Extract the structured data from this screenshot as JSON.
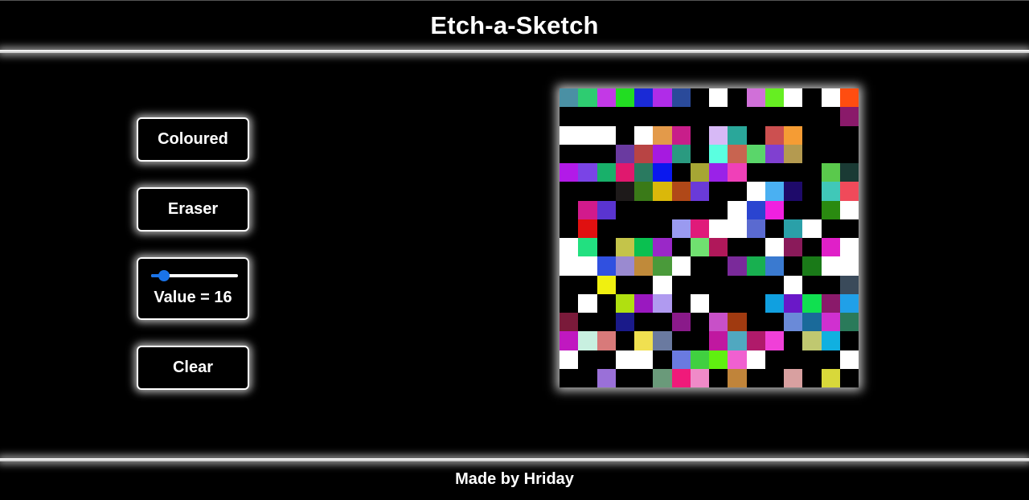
{
  "header": {
    "title": "Etch-a-Sketch"
  },
  "controls": {
    "coloured_label": "Coloured",
    "eraser_label": "Eraser",
    "slider": {
      "value": 16,
      "min": 1,
      "max": 100,
      "label": "Value = 16"
    },
    "clear_label": "Clear"
  },
  "grid": {
    "size": 16,
    "cells": [
      [
        "#4a90a4",
        "#2ecc71",
        "#c339e6",
        "#22dd22",
        "#1a2ad6",
        "#b02ce8",
        "#2a4a9a",
        "#000000",
        "#ffffff",
        "#000000",
        "#d070d8",
        "#66ee22",
        "#ffffff",
        "#000000",
        "#ffffff",
        "#ff4d10"
      ],
      [
        "#000000",
        "#000000",
        "#000000",
        "#000000",
        "#000000",
        "#000000",
        "#000000",
        "#000000",
        "#000000",
        "#000000",
        "#000000",
        "#000000",
        "#000000",
        "#000000",
        "#000000",
        "#8a1a6a"
      ],
      [
        "#ffffff",
        "#ffffff",
        "#ffffff",
        "#000000",
        "#ffffff",
        "#e39a4a",
        "#c81e8a",
        "#000000",
        "#d7b9f6",
        "#2aa79a",
        "#000000",
        "#cc5050",
        "#f59c34",
        "#000000",
        "#000000",
        "#000000"
      ],
      [
        "#000000",
        "#000000",
        "#000000",
        "#6a3aa0",
        "#b84444",
        "#a61ae0",
        "#2a9a80",
        "#000000",
        "#5affe0",
        "#c86450",
        "#5ad66a",
        "#8040d0",
        "#b49a50",
        "#000000",
        "#000000",
        "#000000"
      ],
      [
        "#b21ae8",
        "#7a44e6",
        "#18b06a",
        "#e0186e",
        "#2a7a60",
        "#0a18ee",
        "#000000",
        "#a6a634",
        "#9a22e8",
        "#f040b8",
        "#000000",
        "#000000",
        "#000000",
        "#000000",
        "#5ac94c",
        "#1a3a34"
      ],
      [
        "#000000",
        "#000000",
        "#000000",
        "#1e1a1a",
        "#3a7a18",
        "#dab80a",
        "#b04818",
        "#6a3ad8",
        "#000000",
        "#000000",
        "#ffffff",
        "#4ab0f2",
        "#1e0a6a",
        "#000000",
        "#40c8b8",
        "#f04a5a"
      ],
      [
        "#000000",
        "#d21a8c",
        "#5a34d0",
        "#000000",
        "#000000",
        "#000000",
        "#000000",
        "#000000",
        "#000000",
        "#ffffff",
        "#2a44d0",
        "#f020e0",
        "#000000",
        "#000000",
        "#2a8a10",
        "#ffffff"
      ],
      [
        "#000000",
        "#e01010",
        "#000000",
        "#000000",
        "#000000",
        "#000000",
        "#9a9af0",
        "#e01a7a",
        "#ffffff",
        "#ffffff",
        "#5a6ad0",
        "#000000",
        "#2aa0a8",
        "#ffffff",
        "#000000",
        "#000000"
      ],
      [
        "#ffffff",
        "#22e080",
        "#000000",
        "#c4c44a",
        "#0ac050",
        "#9a28c8",
        "#000000",
        "#70e070",
        "#b0185a",
        "#000000",
        "#000000",
        "#ffffff",
        "#8a1a5a",
        "#000000",
        "#e020c8",
        "#ffffff"
      ],
      [
        "#ffffff",
        "#ffffff",
        "#3050e0",
        "#9a8ad0",
        "#c08a3a",
        "#4a9a3a",
        "#ffffff",
        "#000000",
        "#000000",
        "#7a2a9a",
        "#18b050",
        "#3a7ad0",
        "#000000",
        "#1a7a18",
        "#ffffff",
        "#ffffff"
      ],
      [
        "#000000",
        "#000000",
        "#f0f010",
        "#000000",
        "#000000",
        "#ffffff",
        "#000000",
        "#000000",
        "#000000",
        "#000000",
        "#000000",
        "#000000",
        "#ffffff",
        "#000000",
        "#000000",
        "#3a4a5a"
      ],
      [
        "#000000",
        "#ffffff",
        "#000000",
        "#b0e010",
        "#9a18c0",
        "#b09af0",
        "#000000",
        "#ffffff",
        "#000000",
        "#000000",
        "#000000",
        "#10a0e0",
        "#6a18c8",
        "#10e050",
        "#8a1a6a",
        "#20a0e8"
      ],
      [
        "#7a1a3a",
        "#000000",
        "#000000",
        "#1a1a8a",
        "#000000",
        "#000000",
        "#8a1a8a",
        "#000000",
        "#c850c8",
        "#a03a10",
        "#000000",
        "#000000",
        "#6a8ad8",
        "#1a6a9a",
        "#d030d0",
        "#2a7a5a"
      ],
      [
        "#c018c0",
        "#c8f0e0",
        "#d87a7a",
        "#000000",
        "#f0e050",
        "#6a7aa0",
        "#000000",
        "#000000",
        "#c018a0",
        "#50a8c0",
        "#b01a6a",
        "#f040d8",
        "#000000",
        "#c0c870",
        "#10b0e0",
        "#000000"
      ],
      [
        "#ffffff",
        "#000000",
        "#000000",
        "#ffffff",
        "#ffffff",
        "#000000",
        "#6a7ae0",
        "#40d040",
        "#60f010",
        "#f060d0",
        "#ffffff",
        "#000000",
        "#000000",
        "#000000",
        "#000000",
        "#ffffff"
      ],
      [
        "#000000",
        "#000000",
        "#9a70d8",
        "#000000",
        "#000000",
        "#6a9a7a",
        "#f01a7a",
        "#f08ac8",
        "#000000",
        "#c0843a",
        "#000000",
        "#000000",
        "#d8a0a0",
        "#000000",
        "#d8d83a",
        "#000000"
      ]
    ]
  },
  "footer": {
    "text": "Made by Hriday"
  }
}
